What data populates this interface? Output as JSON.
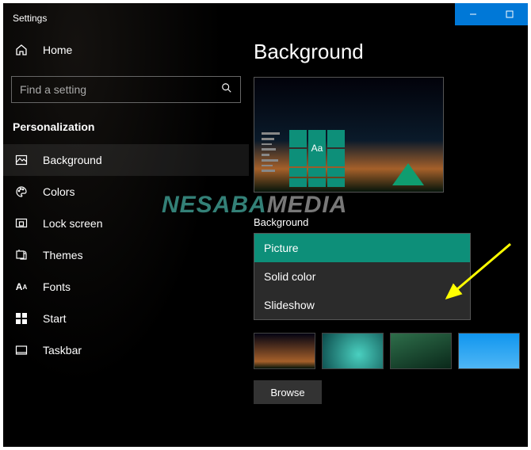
{
  "windowTitle": "Settings",
  "sidebar": {
    "home": "Home",
    "searchPlaceholder": "Find a setting",
    "category": "Personalization",
    "items": [
      {
        "label": "Background"
      },
      {
        "label": "Colors"
      },
      {
        "label": "Lock screen"
      },
      {
        "label": "Themes"
      },
      {
        "label": "Fonts"
      },
      {
        "label": "Start"
      },
      {
        "label": "Taskbar"
      }
    ]
  },
  "page": {
    "title": "Background",
    "previewTile": "Aa",
    "fieldLabel": "Background",
    "dropdown": {
      "selected": "Picture",
      "options": [
        "Picture",
        "Solid color",
        "Slideshow"
      ]
    },
    "browse": "Browse"
  },
  "watermark": {
    "a": "NESABA",
    "b": "MEDIA"
  },
  "colors": {
    "accent": "#0d8f79",
    "winBlue": "#0078d7"
  }
}
